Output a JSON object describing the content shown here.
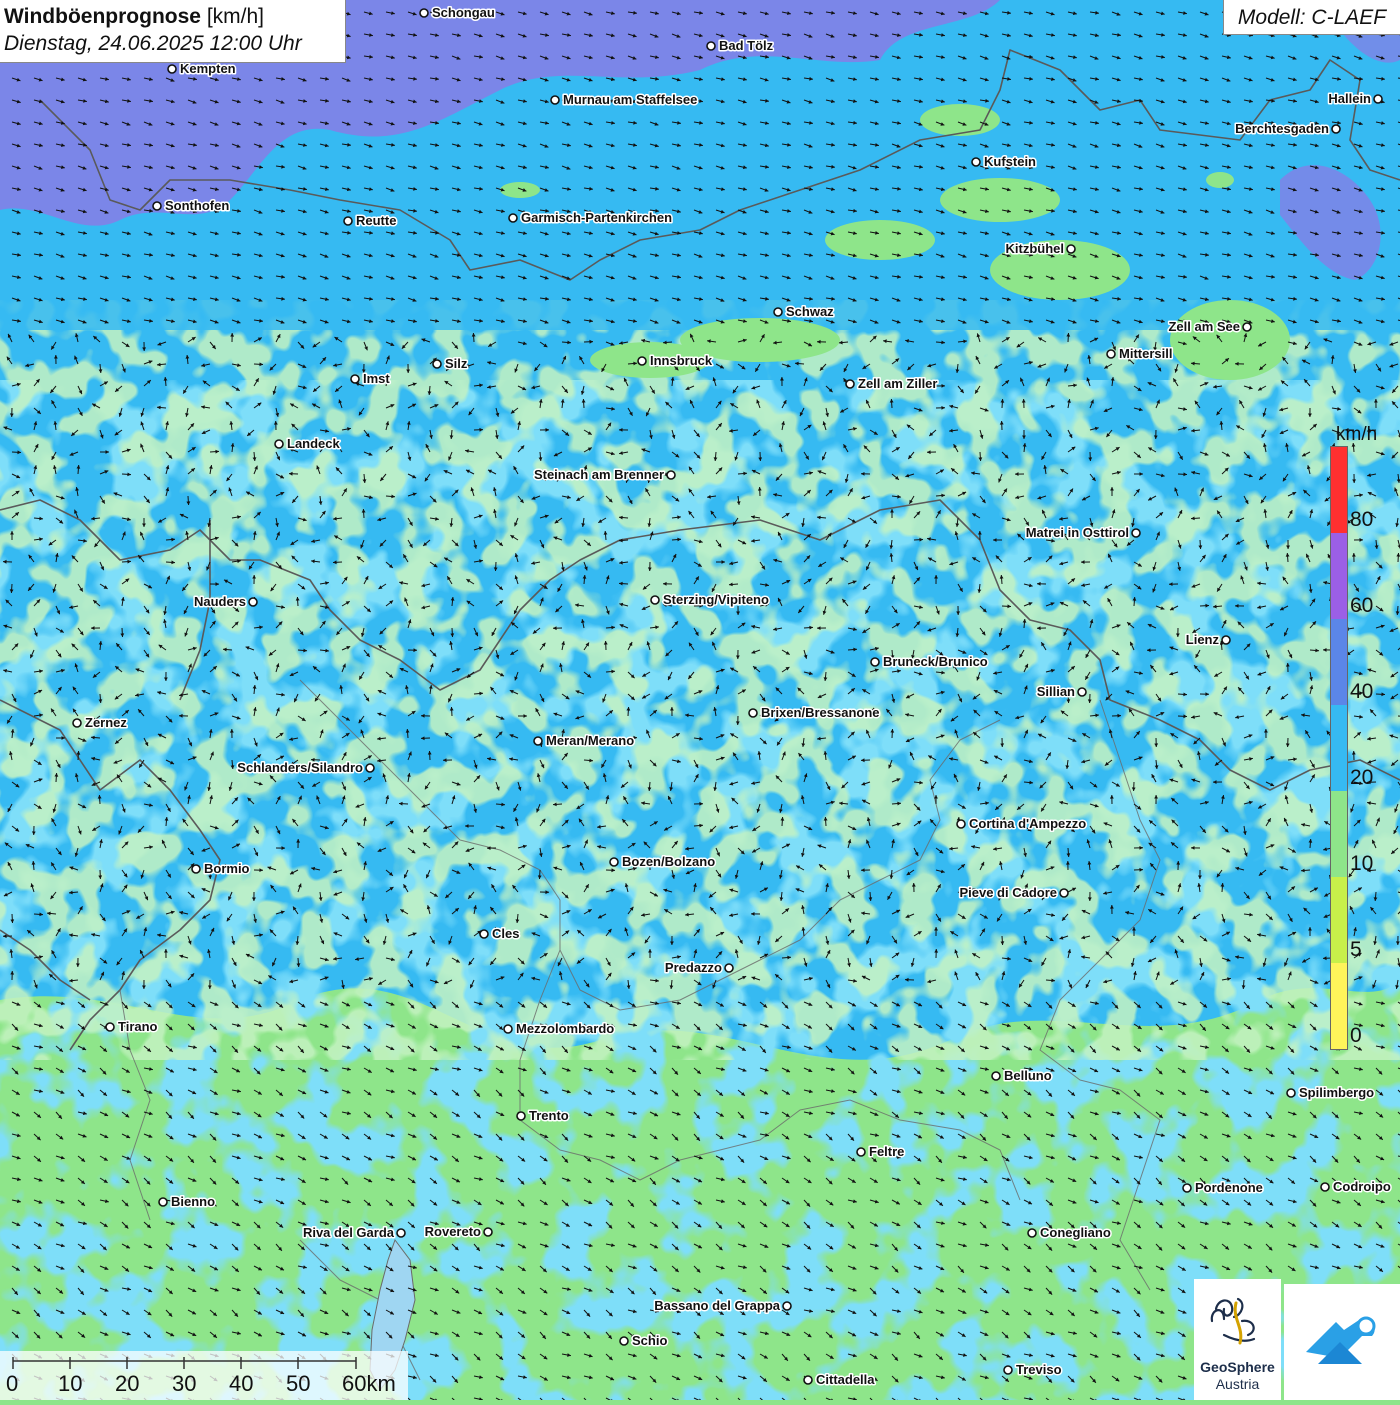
{
  "title": {
    "bold": "Windböenprognose",
    "unit": "[km/h]",
    "datetime": "Dienstag, 24.06.2025 12:00 Uhr"
  },
  "model": "Modell: C-LAEF",
  "legend": {
    "unit": "km/h",
    "ticks": [
      "80",
      "60",
      "40",
      "20",
      "10",
      "5",
      "0"
    ],
    "colors": [
      "#ff3030",
      "#9b5fe6",
      "#5b86e8",
      "#36baf2",
      "#8ee58a",
      "#c8f04a",
      "#fff45a"
    ]
  },
  "scalebar": {
    "labels": [
      "0",
      "10",
      "20",
      "30",
      "40",
      "50",
      "60km"
    ]
  },
  "logo": {
    "line1": "GeoSphere",
    "line2": "Austria"
  },
  "colors": {
    "blue_zone": "#36baf2",
    "green_zone": "#8ee58a",
    "purple_zone": "#7b86e8",
    "border": "#5a5a5a"
  },
  "cities": [
    {
      "name": "Schongau",
      "label_side": "right"
    },
    {
      "name": "Bad Tölz",
      "label_side": "right"
    },
    {
      "name": "Kempten",
      "label_side": "right"
    },
    {
      "name": "Murnau am Staffelsee",
      "label_side": "right"
    },
    {
      "name": "Hallein",
      "label_side": "left"
    },
    {
      "name": "Berchtesgaden",
      "label_side": "left"
    },
    {
      "name": "Kufstein",
      "label_side": "right"
    },
    {
      "name": "Sonthofen",
      "label_side": "right"
    },
    {
      "name": "Reutte",
      "label_side": "right"
    },
    {
      "name": "Garmisch-Partenkirchen",
      "label_side": "right"
    },
    {
      "name": "Kitzbühel",
      "label_side": "left"
    },
    {
      "name": "Schwaz",
      "label_side": "right"
    },
    {
      "name": "Zell am See",
      "label_side": "left"
    },
    {
      "name": "Innsbruck",
      "label_side": "right"
    },
    {
      "name": "Silz",
      "label_side": "right"
    },
    {
      "name": "Mittersill",
      "label_side": "right"
    },
    {
      "name": "Imst",
      "label_side": "right"
    },
    {
      "name": "Zell am Ziller",
      "label_side": "right"
    },
    {
      "name": "Landeck",
      "label_side": "right"
    },
    {
      "name": "Steinach am Brenner",
      "label_side": "left"
    },
    {
      "name": "Matrei in Osttirol",
      "label_side": "left"
    },
    {
      "name": "Nauders",
      "label_side": "left"
    },
    {
      "name": "Sterzing/Vipiteno",
      "label_side": "right"
    },
    {
      "name": "Lienz",
      "label_side": "left"
    },
    {
      "name": "Bruneck/Brunico",
      "label_side": "right"
    },
    {
      "name": "Sillian",
      "label_side": "left"
    },
    {
      "name": "Brixen/Bressanone",
      "label_side": "right"
    },
    {
      "name": "Zernez",
      "label_side": "right"
    },
    {
      "name": "Meran/Merano",
      "label_side": "right"
    },
    {
      "name": "Schlanders/Silandro",
      "label_side": "left"
    },
    {
      "name": "Cortina d'Ampezzo",
      "label_side": "right"
    },
    {
      "name": "Bozen/Bolzano",
      "label_side": "right"
    },
    {
      "name": "Bormio",
      "label_side": "right"
    },
    {
      "name": "Pieve di Cadore",
      "label_side": "left"
    },
    {
      "name": "Cles",
      "label_side": "right"
    },
    {
      "name": "Predazzo",
      "label_side": "left"
    },
    {
      "name": "Tirano",
      "label_side": "right"
    },
    {
      "name": "Mezzolombardo",
      "label_side": "right"
    },
    {
      "name": "Belluno",
      "label_side": "right"
    },
    {
      "name": "Spilimbergo",
      "label_side": "right"
    },
    {
      "name": "Trento",
      "label_side": "right"
    },
    {
      "name": "Feltre",
      "label_side": "right"
    },
    {
      "name": "Pordenone",
      "label_side": "right"
    },
    {
      "name": "Codroipo",
      "label_side": "right"
    },
    {
      "name": "Bienno",
      "label_side": "right"
    },
    {
      "name": "Riva del Garda",
      "label_side": "left"
    },
    {
      "name": "Rovereto",
      "label_side": "left"
    },
    {
      "name": "Conegliano",
      "label_side": "right"
    },
    {
      "name": "Bassano del Grappa",
      "label_side": "left"
    },
    {
      "name": "Schio",
      "label_side": "right"
    },
    {
      "name": "Treviso",
      "label_side": "right"
    },
    {
      "name": "Cittadella",
      "label_side": "right"
    }
  ]
}
